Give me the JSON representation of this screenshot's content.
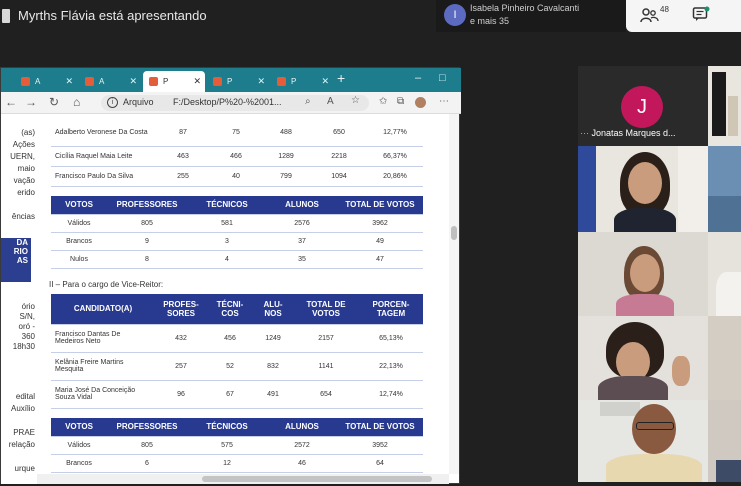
{
  "header": {
    "presenting_text": "Myrths Flávia está apresentando",
    "viewer_name": "Isabela Pinheiro Cavalcanti",
    "viewer_more": "e mais 35",
    "viewer_initial": "I",
    "participant_count": "48"
  },
  "browser": {
    "tabs": [
      {
        "label": "A",
        "icon": "pdf-icon"
      },
      {
        "label": "A",
        "icon": "pdf-icon"
      },
      {
        "label": "P",
        "icon": "pdf-icon"
      },
      {
        "label": "P",
        "icon": "pdf-icon"
      },
      {
        "label": "P",
        "icon": "pdf-icon"
      }
    ],
    "new_tab": "+",
    "url_label": "Arquivo",
    "url": "F:/Desktop/P%20-%2001..."
  },
  "left_doc": {
    "lines": [
      "(as)",
      "Ações",
      "UERN,",
      "maio",
      "vação",
      "erido",
      "ências",
      "DA",
      "RIO",
      "AS",
      "ório",
      "S/N,",
      "oró -",
      "360",
      "18h30",
      "edital",
      "Auxílio",
      "PRAE",
      "relação",
      "urque"
    ]
  },
  "doc": {
    "table_rector_candidates": {
      "rows": [
        {
          "name": "Adalberto Veronese Da Costa",
          "professores": "87",
          "tecnicos": "75",
          "alunos": "488",
          "total": "650",
          "porcentagem": "12,77%"
        },
        {
          "name": "Cicília Raquel Maia Leite",
          "professores": "463",
          "tecnicos": "466",
          "alunos": "1289",
          "total": "2218",
          "porcentagem": "66,37%"
        },
        {
          "name": "Francisco Paulo Da Silva",
          "professores": "255",
          "tecnicos": "40",
          "alunos": "799",
          "total": "1094",
          "porcentagem": "20,86%"
        }
      ]
    },
    "table_rector_votes": {
      "headers": [
        "VOTOS",
        "PROFESSORES",
        "TÉCNICOS",
        "ALUNOS",
        "TOTAL DE VOTOS"
      ],
      "rows": [
        {
          "label": "Válidos",
          "professores": "805",
          "tecnicos": "581",
          "alunos": "2576",
          "total": "3962"
        },
        {
          "label": "Brancos",
          "professores": "9",
          "tecnicos": "3",
          "alunos": "37",
          "total": "49"
        },
        {
          "label": "Nulos",
          "professores": "8",
          "tecnicos": "4",
          "alunos": "35",
          "total": "47"
        }
      ]
    },
    "section_vice": "II – Para o cargo de Vice-Reitor:",
    "table_vice_candidates": {
      "headers": [
        "CANDIDATO(A)",
        "PROFES-SORES",
        "TÉCNI-COS",
        "ALU-NOS",
        "TOTAL DE VOTOS",
        "PORCEN-TAGEM"
      ],
      "rows": [
        {
          "name": "Francisco Dantas De Medeiros Neto",
          "professores": "432",
          "tecnicos": "456",
          "alunos": "1249",
          "total": "2157",
          "porcentagem": "65,13%"
        },
        {
          "name": "Kelânia Freire Martins Mesquita",
          "professores": "257",
          "tecnicos": "52",
          "alunos": "832",
          "total": "1141",
          "porcentagem": "22,13%"
        },
        {
          "name": "Maria José Da Conceição Souza Vidal",
          "professores": "96",
          "tecnicos": "67",
          "alunos": "491",
          "total": "654",
          "porcentagem": "12,74%"
        }
      ]
    },
    "table_vice_votes": {
      "headers": [
        "VOTOS",
        "PROFESSORES",
        "TÉCNICOS",
        "ALUNOS",
        "TOTAL DE VOTOS"
      ],
      "rows": [
        {
          "label": "Válidos",
          "professores": "805",
          "tecnicos": "575",
          "alunos": "2572",
          "total": "3952"
        },
        {
          "label": "Brancos",
          "professores": "6",
          "tecnicos": "12",
          "alunos": "46",
          "total": "64"
        }
      ]
    }
  },
  "participants": {
    "featured_initial": "J",
    "featured_name": "Jonatas Marques d..."
  },
  "colors": {
    "table_header": "#283a8f",
    "tabstrip": "#1e7d8c",
    "avatar_j": "#c2185b",
    "avatar_i": "#5c6bc0"
  }
}
